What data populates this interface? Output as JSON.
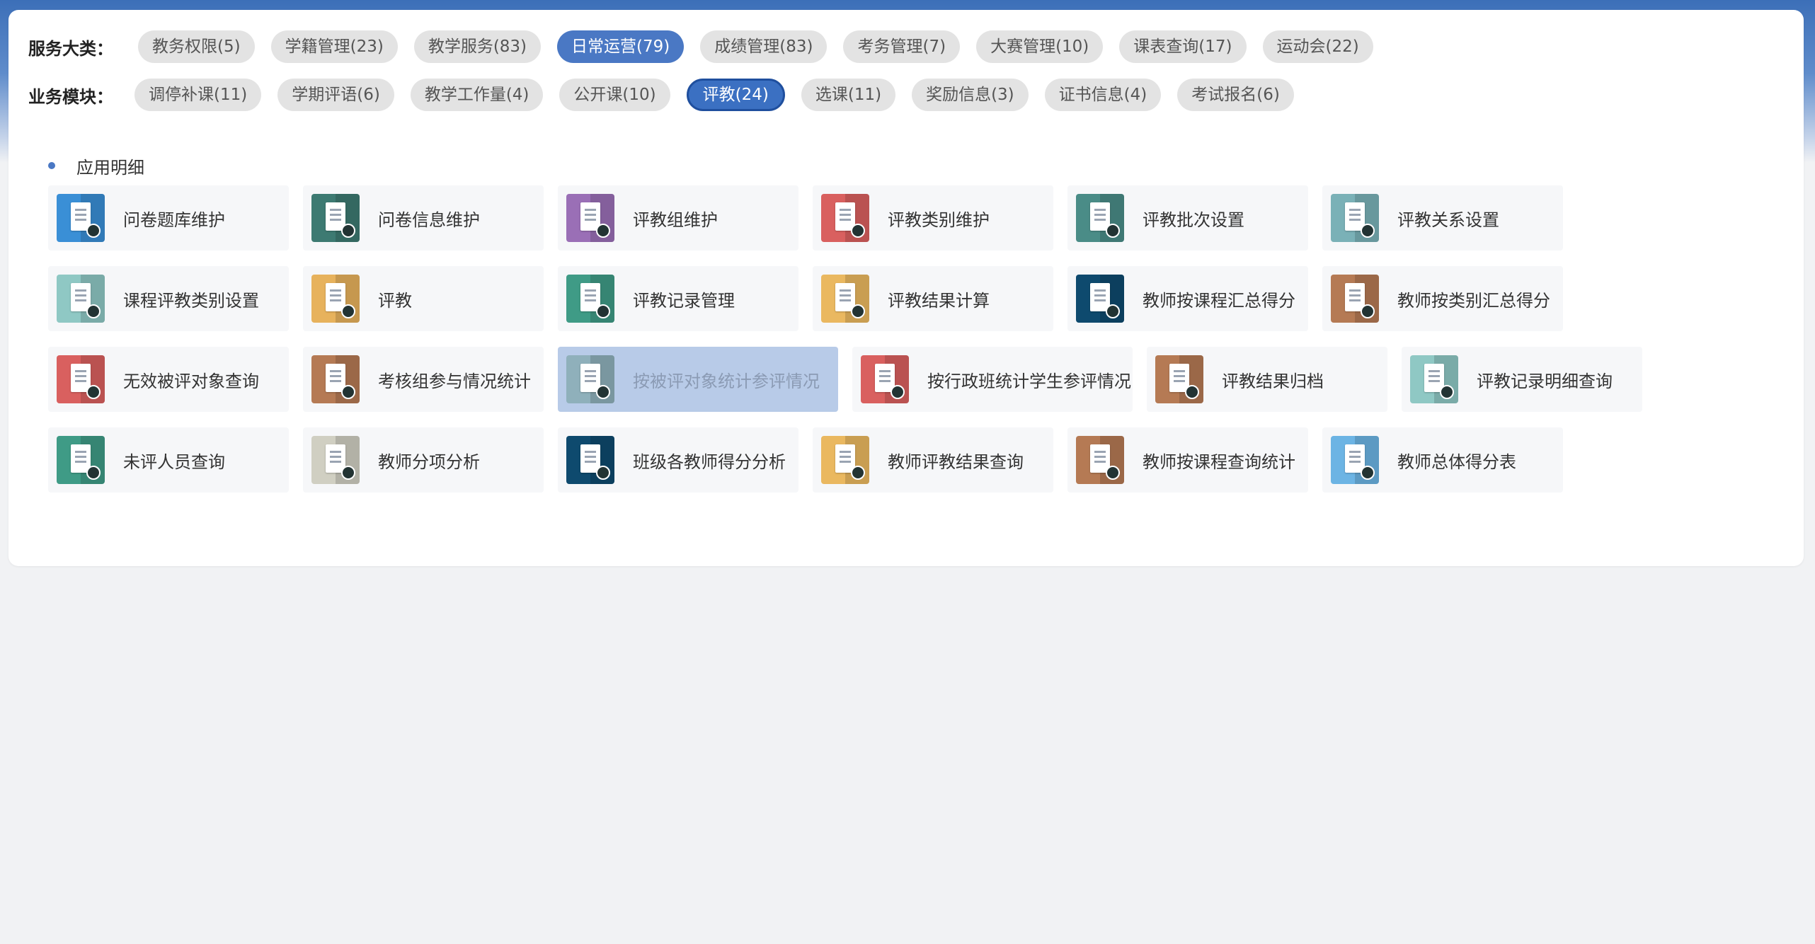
{
  "filters": {
    "category_label": "服务大类：",
    "categories": [
      {
        "label": "教务权限(5)",
        "active": false
      },
      {
        "label": "学籍管理(23)",
        "active": false
      },
      {
        "label": "教学服务(83)",
        "active": false
      },
      {
        "label": "日常运营(79)",
        "active": true
      },
      {
        "label": "成绩管理(83)",
        "active": false
      },
      {
        "label": "考务管理(7)",
        "active": false
      },
      {
        "label": "大赛管理(10)",
        "active": false
      },
      {
        "label": "课表查询(17)",
        "active": false
      },
      {
        "label": "运动会(22)",
        "active": false
      }
    ],
    "module_label": "业务模块：",
    "modules": [
      {
        "label": "调停补课(11)",
        "active": false
      },
      {
        "label": "学期评语(6)",
        "active": false
      },
      {
        "label": "教学工作量(4)",
        "active": false
      },
      {
        "label": "公开课(10)",
        "active": false
      },
      {
        "label": "评教(24)",
        "active": true
      },
      {
        "label": "选课(11)",
        "active": false
      },
      {
        "label": "奖励信息(3)",
        "active": false
      },
      {
        "label": "证书信息(4)",
        "active": false
      },
      {
        "label": "考试报名(6)",
        "active": false
      }
    ]
  },
  "section": {
    "title": "应用明细"
  },
  "apps": [
    [
      {
        "label": "问卷题库维护",
        "icon": "form-settings-icon",
        "color": "#3a8fd6"
      },
      {
        "label": "问卷信息维护",
        "icon": "clipboard-tools-icon",
        "color": "#3d7a72"
      },
      {
        "label": "评教组维护",
        "icon": "notepad-icon",
        "color": "#9a6fb6"
      },
      {
        "label": "评教类别维护",
        "icon": "cube-icon",
        "color": "#d9605f"
      },
      {
        "label": "评教批次设置",
        "icon": "clipboard-clock-icon",
        "color": "#4a8c87"
      },
      {
        "label": "评教关系设置",
        "icon": "tablet-user-icon",
        "color": "#7ab1b7"
      }
    ],
    [
      {
        "label": "课程评教类别设置",
        "icon": "clipboard-gear-icon",
        "color": "#8fc8c4"
      },
      {
        "label": "评教",
        "icon": "clipboard-pen-icon",
        "color": "#e7b25c"
      },
      {
        "label": "评教记录管理",
        "icon": "documents-icon",
        "color": "#3f9b86"
      },
      {
        "label": "评教结果计算",
        "icon": "monitor-icon",
        "color": "#eab860"
      },
      {
        "label": "教师按课程汇总得分",
        "icon": "calendar-check-icon",
        "color": "#0e4a6e"
      },
      {
        "label": "教师按类别汇总得分",
        "icon": "certificate-icon",
        "color": "#b57a54"
      }
    ],
    [
      {
        "label": "无效被评对象查询",
        "icon": "id-card-search-icon",
        "color": "#d9605f"
      },
      {
        "label": "考核组参与情况统计",
        "icon": "monitor-chart-icon",
        "color": "#b57a54"
      },
      {
        "label": "按被评对象统计参评情况",
        "icon": "open-book-icon",
        "color": "#8fb0bb",
        "highlight": true,
        "wide": true
      },
      {
        "label": "按行政班统计学生参评情况",
        "icon": "monitor-pulse-icon",
        "color": "#d9605f",
        "wide": true
      },
      {
        "label": "评教结果归档",
        "icon": "clipboard-archive-icon",
        "color": "#b57a54"
      },
      {
        "label": "评教记录明细查询",
        "icon": "clipboard-user-icon",
        "color": "#8fc8c4"
      }
    ],
    [
      {
        "label": "未评人员查询",
        "icon": "clipboard-check-icon",
        "color": "#3f9b86"
      },
      {
        "label": "教师分项分析",
        "icon": "presentation-board-icon",
        "color": "#d0cfc2"
      },
      {
        "label": "班级各教师得分分析",
        "icon": "calendar-check-icon",
        "color": "#0e4a6e"
      },
      {
        "label": "教师评教结果查询",
        "icon": "document-pen-icon",
        "color": "#eab860"
      },
      {
        "label": "教师按课程查询统计",
        "icon": "clipboard-list-icon",
        "color": "#b57a54"
      },
      {
        "label": "教师总体得分表",
        "icon": "building-user-icon",
        "color": "#6cb4e4"
      }
    ]
  ]
}
